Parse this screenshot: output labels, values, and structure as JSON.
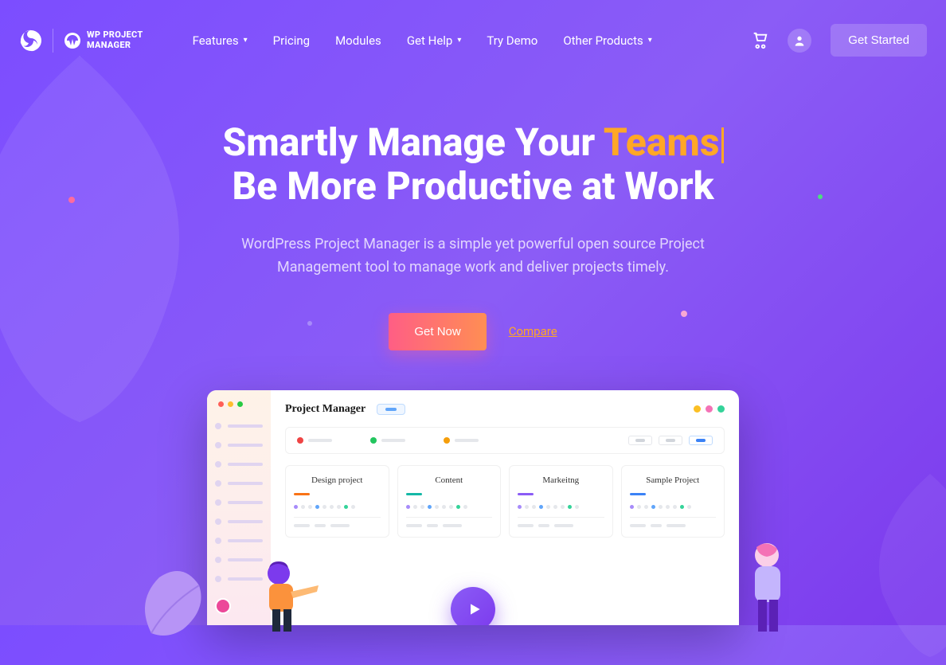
{
  "brand": {
    "name_line1": "WP PROJECT",
    "name_line2": "MANAGER"
  },
  "nav": {
    "features": "Features",
    "pricing": "Pricing",
    "modules": "Modules",
    "get_help": "Get Help",
    "try_demo": "Try Demo",
    "other_products": "Other Products"
  },
  "header": {
    "get_started": "Get Started"
  },
  "hero": {
    "title_part1": "Smartly Manage Your ",
    "title_accent": "Teams",
    "title_part2": "Be More Productive at Work",
    "subtitle": "WordPress Project Manager is a simple yet powerful open source Project Management tool to manage work and deliver projects timely.",
    "cta_primary": "Get Now",
    "cta_secondary": "Compare"
  },
  "mockup": {
    "title": "Project Manager",
    "cards": [
      {
        "title": "Design project",
        "color": "#f97316"
      },
      {
        "title": "Content",
        "color": "#14b8a6"
      },
      {
        "title": "Markeitng",
        "color": "#8b5cf6"
      },
      {
        "title": "Sample Project",
        "color": "#3b82f6"
      }
    ],
    "tab_colors": [
      "#ef4444",
      "#22c55e",
      "#f59e0b"
    ],
    "header_dots": [
      "#fbbf24",
      "#f472b6",
      "#34d399"
    ]
  }
}
